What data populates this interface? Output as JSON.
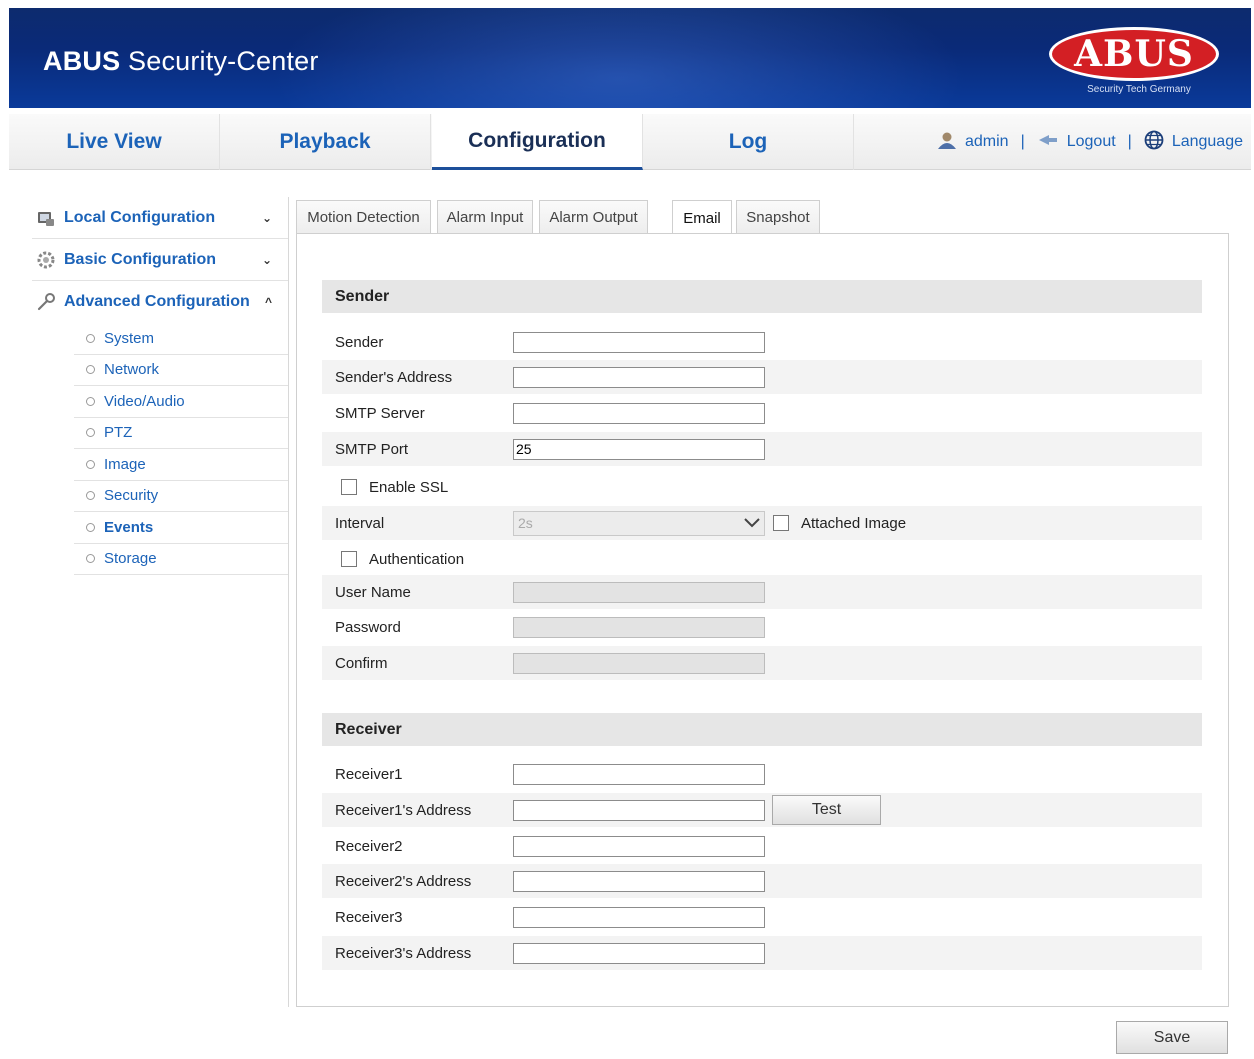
{
  "header": {
    "title_brand": "ABUS",
    "title_rest": " Security-Center",
    "logo_text": "ABUS",
    "logo_tagline": "Security Tech Germany"
  },
  "nav": {
    "tabs": [
      {
        "label": "Live View"
      },
      {
        "label": "Playback"
      },
      {
        "label": "Configuration",
        "active": true
      },
      {
        "label": "Log"
      }
    ],
    "user": "admin",
    "logout": "Logout",
    "language": "Language",
    "separator": "|"
  },
  "sidebar": {
    "sections": [
      {
        "label": "Local Configuration",
        "chevron": "⌄"
      },
      {
        "label": "Basic Configuration",
        "chevron": "⌄"
      },
      {
        "label": "Advanced Configuration",
        "chevron": "^"
      }
    ],
    "items": [
      {
        "label": "System"
      },
      {
        "label": "Network"
      },
      {
        "label": "Video/Audio"
      },
      {
        "label": "PTZ"
      },
      {
        "label": "Image"
      },
      {
        "label": "Security"
      },
      {
        "label": "Events"
      },
      {
        "label": "Storage"
      }
    ]
  },
  "subtabs": [
    {
      "label": "Motion Detection"
    },
    {
      "label": "Alarm Input"
    },
    {
      "label": "Alarm Output"
    },
    {
      "label": "Email",
      "active": true
    },
    {
      "label": "Snapshot"
    }
  ],
  "sender": {
    "heading": "Sender",
    "sender_label": "Sender",
    "sender_value": "",
    "address_label": "Sender's Address",
    "address_value": "",
    "smtp_server_label": "SMTP Server",
    "smtp_server_value": "",
    "smtp_port_label": "SMTP Port",
    "smtp_port_value": "25",
    "enable_ssl_label": "Enable SSL",
    "interval_label": "Interval",
    "interval_value": "2s",
    "attached_image_label": "Attached Image",
    "authentication_label": "Authentication",
    "username_label": "User Name",
    "password_label": "Password",
    "confirm_label": "Confirm"
  },
  "receiver": {
    "heading": "Receiver",
    "receiver1_label": "Receiver1",
    "receiver1_address_label": "Receiver1's Address",
    "test_label": "Test",
    "receiver2_label": "Receiver2",
    "receiver2_address_label": "Receiver2's Address",
    "receiver3_label": "Receiver3",
    "receiver3_address_label": "Receiver3's Address"
  },
  "save_label": "Save"
}
